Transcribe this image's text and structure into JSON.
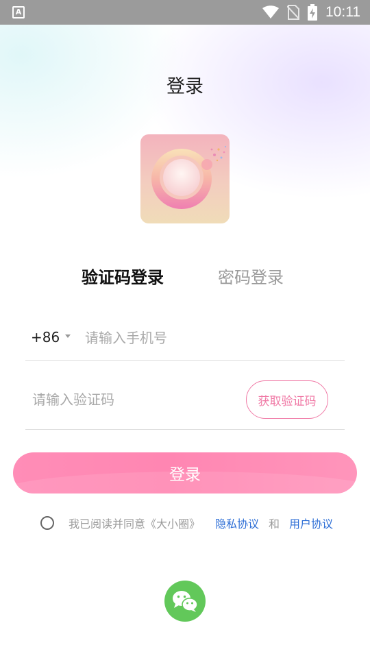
{
  "status_bar": {
    "app_indicator": "A",
    "time": "10:11",
    "icons": [
      "wifi-icon",
      "no-sim-icon",
      "battery-charging-icon"
    ]
  },
  "page": {
    "title": "登录"
  },
  "tabs": {
    "sms_login": "验证码登录",
    "password_login": "密码登录",
    "active": "sms_login"
  },
  "phone": {
    "country_code": "+86",
    "placeholder": "请输入手机号",
    "value": ""
  },
  "code": {
    "placeholder": "请输入验证码",
    "value": "",
    "get_code_label": "获取验证码"
  },
  "login_button": {
    "label": "登录"
  },
  "agreement": {
    "checked": false,
    "text": "我已阅读并同意《大小圈》",
    "privacy_link": "隐私协议",
    "and": "和",
    "user_link": "用户协议"
  },
  "third_party": {
    "wechat_icon": "wechat-icon"
  },
  "colors": {
    "accent_pink": "#ff86b2",
    "link_blue": "#2d6ed6",
    "wechat_green": "#62c85a",
    "status_bar": "#9b9b9b"
  }
}
